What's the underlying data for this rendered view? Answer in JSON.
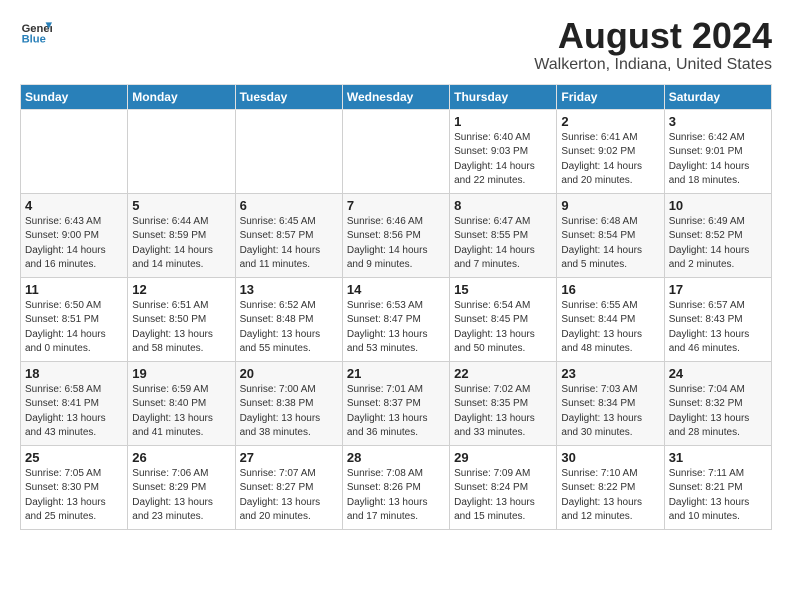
{
  "header": {
    "logo_line1": "General",
    "logo_line2": "Blue",
    "title": "August 2024",
    "subtitle": "Walkerton, Indiana, United States"
  },
  "days_of_week": [
    "Sunday",
    "Monday",
    "Tuesday",
    "Wednesday",
    "Thursday",
    "Friday",
    "Saturday"
  ],
  "weeks": [
    [
      {
        "day": "",
        "content": ""
      },
      {
        "day": "",
        "content": ""
      },
      {
        "day": "",
        "content": ""
      },
      {
        "day": "",
        "content": ""
      },
      {
        "day": "1",
        "content": "Sunrise: 6:40 AM\nSunset: 9:03 PM\nDaylight: 14 hours\nand 22 minutes."
      },
      {
        "day": "2",
        "content": "Sunrise: 6:41 AM\nSunset: 9:02 PM\nDaylight: 14 hours\nand 20 minutes."
      },
      {
        "day": "3",
        "content": "Sunrise: 6:42 AM\nSunset: 9:01 PM\nDaylight: 14 hours\nand 18 minutes."
      }
    ],
    [
      {
        "day": "4",
        "content": "Sunrise: 6:43 AM\nSunset: 9:00 PM\nDaylight: 14 hours\nand 16 minutes."
      },
      {
        "day": "5",
        "content": "Sunrise: 6:44 AM\nSunset: 8:59 PM\nDaylight: 14 hours\nand 14 minutes."
      },
      {
        "day": "6",
        "content": "Sunrise: 6:45 AM\nSunset: 8:57 PM\nDaylight: 14 hours\nand 11 minutes."
      },
      {
        "day": "7",
        "content": "Sunrise: 6:46 AM\nSunset: 8:56 PM\nDaylight: 14 hours\nand 9 minutes."
      },
      {
        "day": "8",
        "content": "Sunrise: 6:47 AM\nSunset: 8:55 PM\nDaylight: 14 hours\nand 7 minutes."
      },
      {
        "day": "9",
        "content": "Sunrise: 6:48 AM\nSunset: 8:54 PM\nDaylight: 14 hours\nand 5 minutes."
      },
      {
        "day": "10",
        "content": "Sunrise: 6:49 AM\nSunset: 8:52 PM\nDaylight: 14 hours\nand 2 minutes."
      }
    ],
    [
      {
        "day": "11",
        "content": "Sunrise: 6:50 AM\nSunset: 8:51 PM\nDaylight: 14 hours\nand 0 minutes."
      },
      {
        "day": "12",
        "content": "Sunrise: 6:51 AM\nSunset: 8:50 PM\nDaylight: 13 hours\nand 58 minutes."
      },
      {
        "day": "13",
        "content": "Sunrise: 6:52 AM\nSunset: 8:48 PM\nDaylight: 13 hours\nand 55 minutes."
      },
      {
        "day": "14",
        "content": "Sunrise: 6:53 AM\nSunset: 8:47 PM\nDaylight: 13 hours\nand 53 minutes."
      },
      {
        "day": "15",
        "content": "Sunrise: 6:54 AM\nSunset: 8:45 PM\nDaylight: 13 hours\nand 50 minutes."
      },
      {
        "day": "16",
        "content": "Sunrise: 6:55 AM\nSunset: 8:44 PM\nDaylight: 13 hours\nand 48 minutes."
      },
      {
        "day": "17",
        "content": "Sunrise: 6:57 AM\nSunset: 8:43 PM\nDaylight: 13 hours\nand 46 minutes."
      }
    ],
    [
      {
        "day": "18",
        "content": "Sunrise: 6:58 AM\nSunset: 8:41 PM\nDaylight: 13 hours\nand 43 minutes."
      },
      {
        "day": "19",
        "content": "Sunrise: 6:59 AM\nSunset: 8:40 PM\nDaylight: 13 hours\nand 41 minutes."
      },
      {
        "day": "20",
        "content": "Sunrise: 7:00 AM\nSunset: 8:38 PM\nDaylight: 13 hours\nand 38 minutes."
      },
      {
        "day": "21",
        "content": "Sunrise: 7:01 AM\nSunset: 8:37 PM\nDaylight: 13 hours\nand 36 minutes."
      },
      {
        "day": "22",
        "content": "Sunrise: 7:02 AM\nSunset: 8:35 PM\nDaylight: 13 hours\nand 33 minutes."
      },
      {
        "day": "23",
        "content": "Sunrise: 7:03 AM\nSunset: 8:34 PM\nDaylight: 13 hours\nand 30 minutes."
      },
      {
        "day": "24",
        "content": "Sunrise: 7:04 AM\nSunset: 8:32 PM\nDaylight: 13 hours\nand 28 minutes."
      }
    ],
    [
      {
        "day": "25",
        "content": "Sunrise: 7:05 AM\nSunset: 8:30 PM\nDaylight: 13 hours\nand 25 minutes."
      },
      {
        "day": "26",
        "content": "Sunrise: 7:06 AM\nSunset: 8:29 PM\nDaylight: 13 hours\nand 23 minutes."
      },
      {
        "day": "27",
        "content": "Sunrise: 7:07 AM\nSunset: 8:27 PM\nDaylight: 13 hours\nand 20 minutes."
      },
      {
        "day": "28",
        "content": "Sunrise: 7:08 AM\nSunset: 8:26 PM\nDaylight: 13 hours\nand 17 minutes."
      },
      {
        "day": "29",
        "content": "Sunrise: 7:09 AM\nSunset: 8:24 PM\nDaylight: 13 hours\nand 15 minutes."
      },
      {
        "day": "30",
        "content": "Sunrise: 7:10 AM\nSunset: 8:22 PM\nDaylight: 13 hours\nand 12 minutes."
      },
      {
        "day": "31",
        "content": "Sunrise: 7:11 AM\nSunset: 8:21 PM\nDaylight: 13 hours\nand 10 minutes."
      }
    ]
  ]
}
